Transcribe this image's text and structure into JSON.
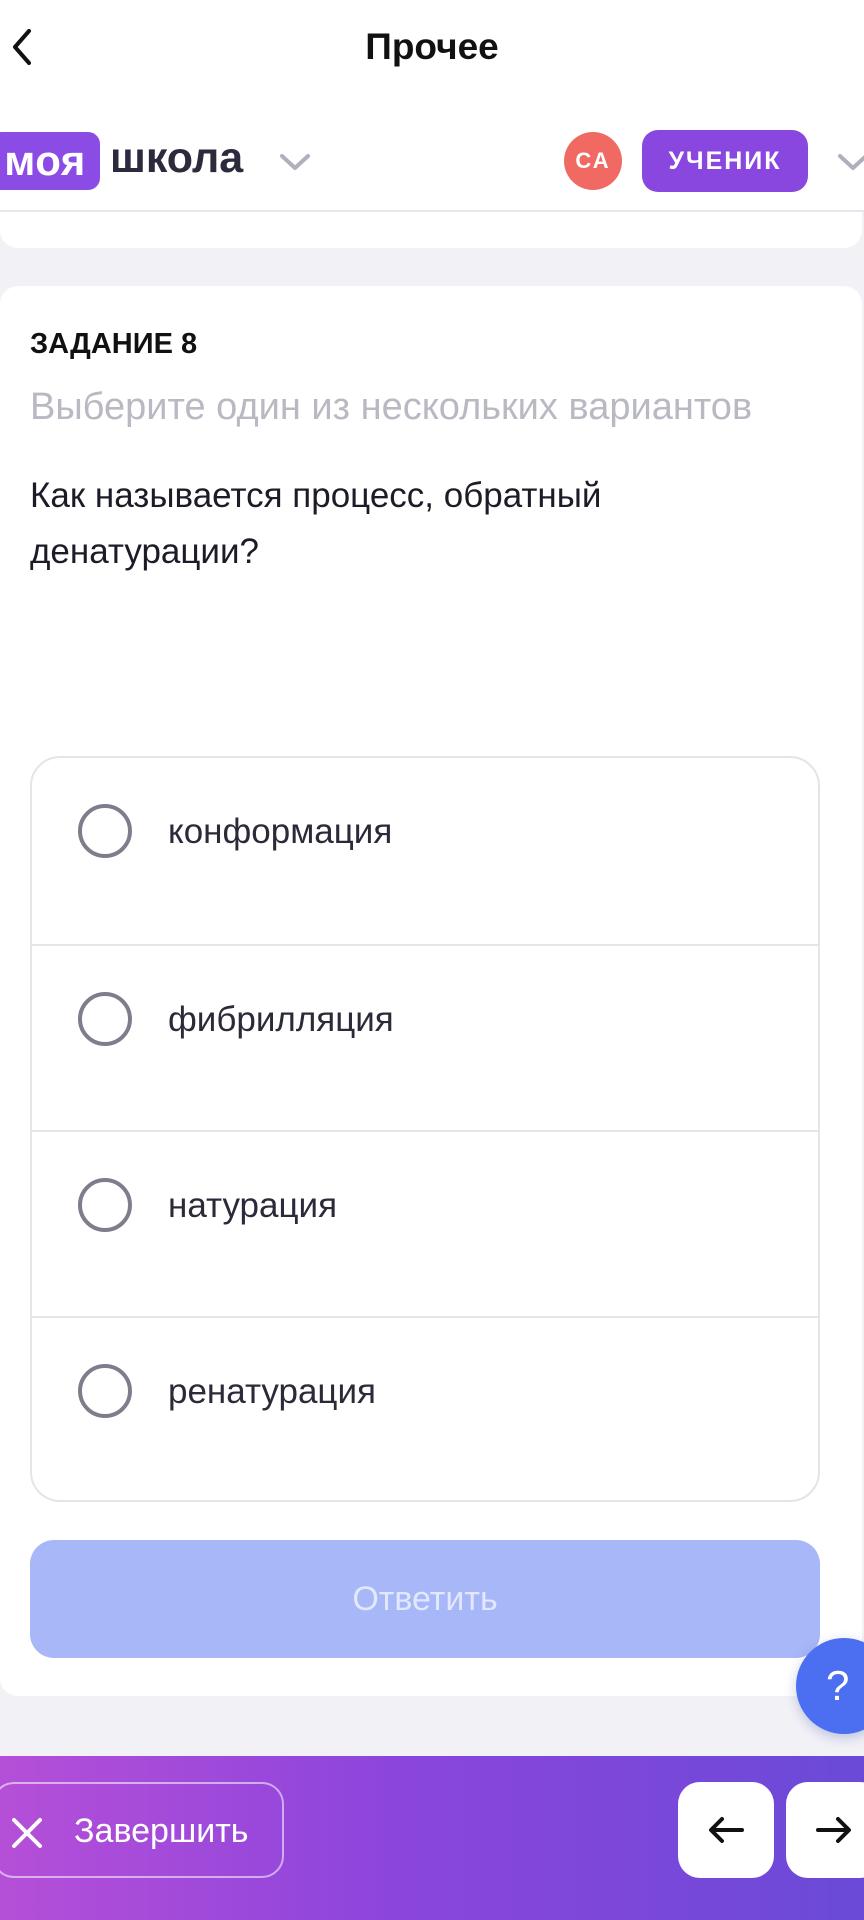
{
  "nav": {
    "title": "Прочее"
  },
  "header": {
    "logo_badge": "моя",
    "logo_word": "школа",
    "avatar_initials": "СА",
    "role": "УЧЕНИК"
  },
  "task": {
    "number_label": "ЗАДАНИЕ 8",
    "hint": "Выберите один из нескольких вариантов",
    "question": "Как называется процесс, обратный денатурации?",
    "options": [
      "конформация",
      "фибрилляция",
      "натурация",
      "ренатурация"
    ],
    "answer_label": "Ответить"
  },
  "help": {
    "label": "?"
  },
  "bottom": {
    "finish_label": "Завершить"
  },
  "colors": {
    "accent": "#8a47e0",
    "answer_button": "#a8b7f7",
    "help_button": "#4b6ff0",
    "avatar": "#f06a63"
  }
}
